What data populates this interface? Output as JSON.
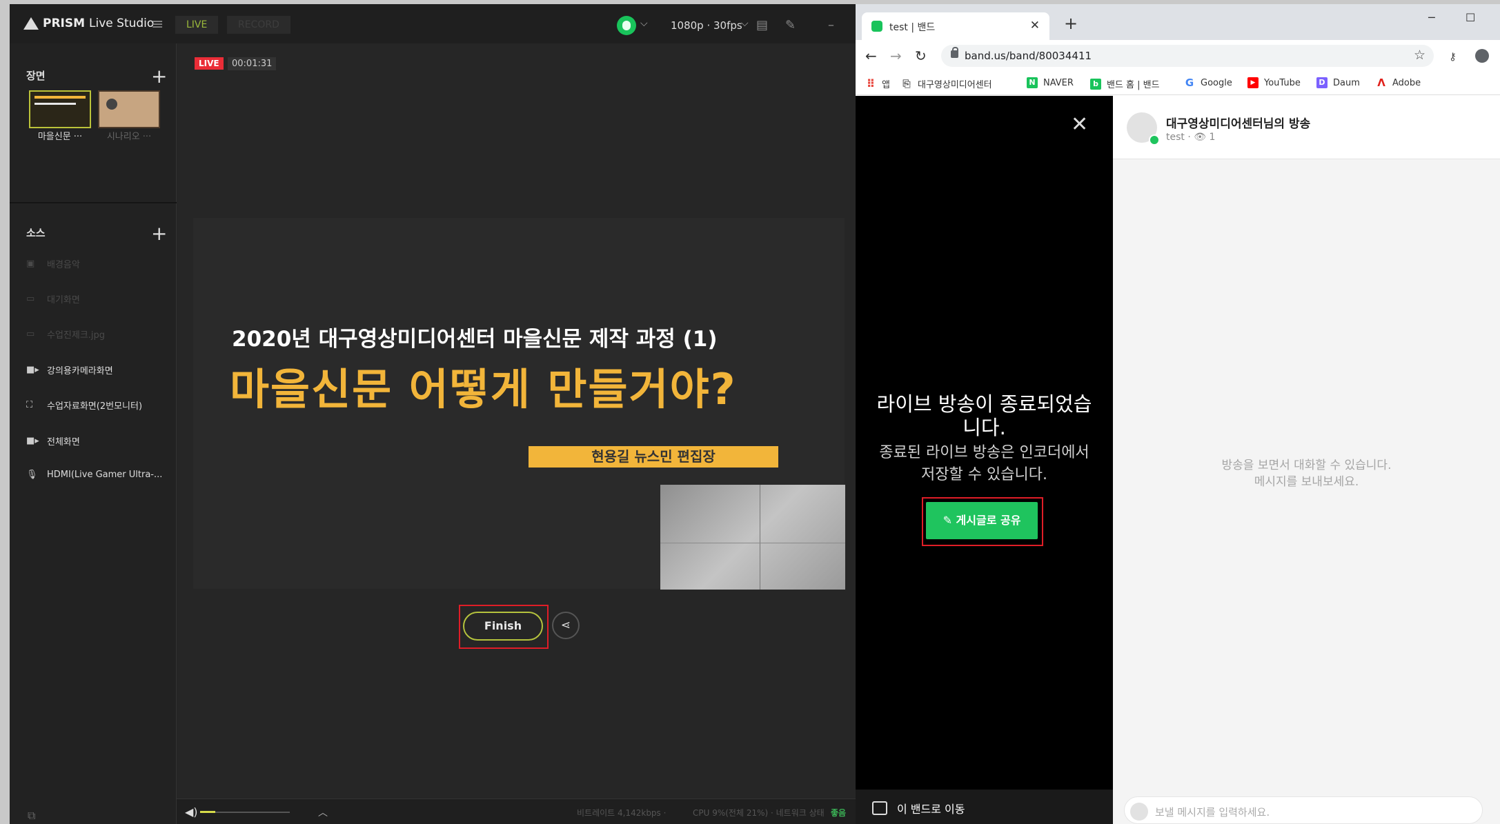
{
  "prism": {
    "app_name": "PRISM",
    "app_name_suffix": "Live Studio",
    "mode_live": "LIVE",
    "mode_record": "RECORD",
    "resolution": "1080p · 30fps",
    "scenes_title": "장면",
    "scenes": [
      {
        "label": "마을신문 ···"
      },
      {
        "label": "시나리오 ···"
      }
    ],
    "sources_title": "소스",
    "sources": [
      {
        "label": "배경음악",
        "icon": "image-icon",
        "active": false
      },
      {
        "label": "대기화면",
        "icon": "image-icon",
        "active": false
      },
      {
        "label": "수업진제크.jpg",
        "icon": "image-icon",
        "active": false
      },
      {
        "label": "강의용카메라화면",
        "icon": "camera-icon",
        "active": true
      },
      {
        "label": "수업자료화면(2번모니터)",
        "icon": "screen-capture-icon",
        "active": true
      },
      {
        "label": "전체화면",
        "icon": "camera-icon",
        "active": true
      },
      {
        "label": "HDMI(Live Gamer Ultra-...",
        "icon": "microphone-icon",
        "active": true
      }
    ],
    "live_badge": "LIVE",
    "live_time": "00:01:31",
    "preview": {
      "subtitle": "2020년 대구영상미디어센터 마을신문 제작 과정 (1)",
      "headline": "마을신문 어떻게 만들거야?",
      "presenter": "현용길 뉴스민 편집장"
    },
    "finish_label": "Finish",
    "status": {
      "bitrate": "비트레이트 4,142kbps ·",
      "cpu": "CPU 9%(전체 21%) · 네트워크 상태",
      "network": "좋음"
    }
  },
  "chrome": {
    "tab_title": "test | 밴드",
    "url": "band.us/band/80034411",
    "bookmarks": [
      {
        "label": "앱",
        "color": "#e8453c"
      },
      {
        "label": "대구영상미디어센터",
        "color": "#666666"
      },
      {
        "label": "NAVER",
        "color": "#19c35b"
      },
      {
        "label": "밴드 홈 | 밴드",
        "color": "#19c35b"
      },
      {
        "label": "Google",
        "color": "#4285f4"
      },
      {
        "label": "YouTube",
        "color": "#ff0000"
      },
      {
        "label": "Daum",
        "color": "#7b61ff"
      },
      {
        "label": "Adobe",
        "color": "#e0201a"
      }
    ]
  },
  "band": {
    "ended_title": "라이브 방송이 종료되었습니다.",
    "ended_title_line1": "라이브 방송이 종료되었습",
    "ended_title_line2": "니다.",
    "ended_desc_line1": "종료된 라이브 방송은 인코더에서",
    "ended_desc_line2": "저장할 수 있습니다.",
    "share_button": "게시글로 공유",
    "go_to_band": "이 밴드로 이동",
    "chat_title": "대구영상미디어센터님의 방송",
    "chat_meta_name": "test ·",
    "chat_meta_viewers": "1",
    "chat_empty_line1": "방송을 보면서 대화할 수 있습니다.",
    "chat_empty_line2": "메시지를 보내보세요.",
    "chat_placeholder": "보낼 메시지를 입력하세요."
  }
}
